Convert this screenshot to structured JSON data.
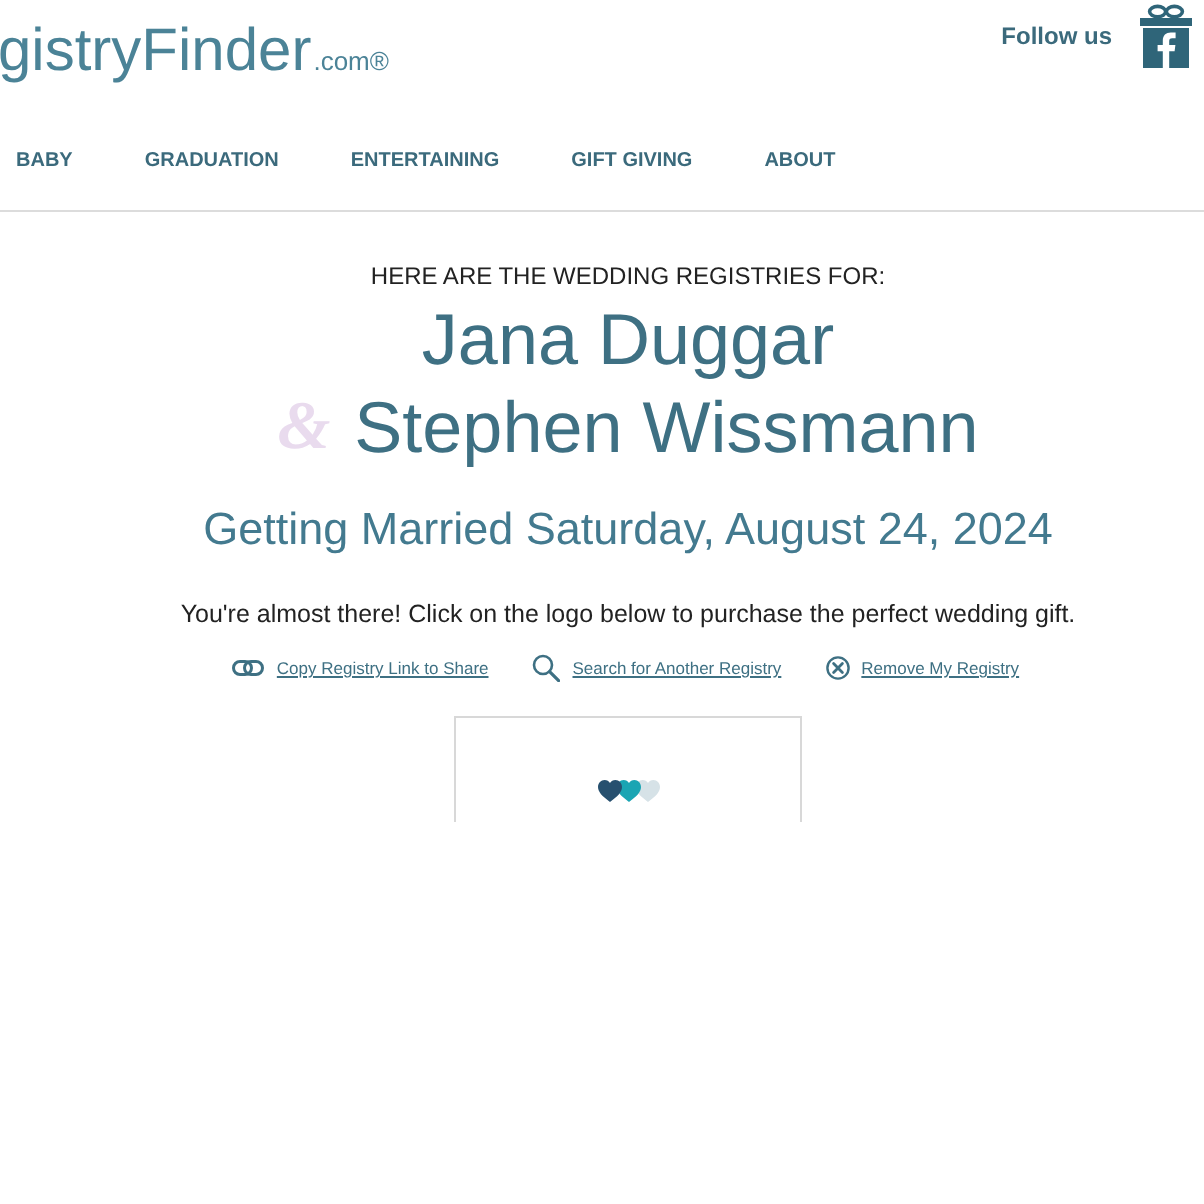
{
  "header": {
    "logo": {
      "name": "gistryFinder",
      "suffix": ".com®"
    },
    "follow": {
      "label": "Follow us"
    }
  },
  "nav": {
    "items": [
      {
        "label": "BABY"
      },
      {
        "label": "GRADUATION"
      },
      {
        "label": "ENTERTAINING"
      },
      {
        "label": "GIFT GIVING"
      },
      {
        "label": "ABOUT"
      }
    ]
  },
  "registry": {
    "intro": "HERE ARE THE WEDDING REGISTRIES FOR:",
    "name_1": "Jana Duggar",
    "ampersand": "&",
    "name_2": "Stephen Wissmann",
    "date": "Getting Married Saturday, August 24, 2024",
    "message": "You're almost there! Click on the logo below to purchase the perfect wedding gift.",
    "links": [
      {
        "kind": "copy",
        "label": "Copy Registry Link to Share"
      },
      {
        "kind": "search",
        "label": "Search for Another Registry"
      },
      {
        "kind": "remove",
        "label": "Remove My Registry"
      }
    ]
  }
}
